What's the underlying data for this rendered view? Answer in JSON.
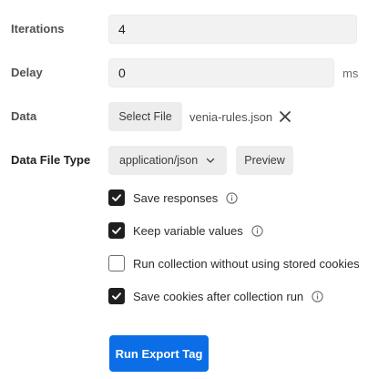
{
  "form": {
    "iterations": {
      "label": "Iterations",
      "value": "4"
    },
    "delay": {
      "label": "Delay",
      "value": "0",
      "unit": "ms"
    },
    "data": {
      "label": "Data",
      "select_file_label": "Select File",
      "file_name": "venia-rules.json"
    },
    "data_file_type": {
      "label": "Data File Type",
      "selected": "application/json",
      "preview_label": "Preview"
    }
  },
  "options": [
    {
      "label": "Save responses",
      "checked": true,
      "info": true
    },
    {
      "label": "Keep variable values",
      "checked": true,
      "info": true
    },
    {
      "label": "Run collection without using stored cookies",
      "checked": false,
      "info": false
    },
    {
      "label": "Save cookies after collection run",
      "checked": true,
      "info": true
    }
  ],
  "run_button": {
    "label": "Run Export Tag"
  },
  "colors": {
    "accent": "#0b6ee6",
    "checkbox_on": "#1f1f1f"
  }
}
